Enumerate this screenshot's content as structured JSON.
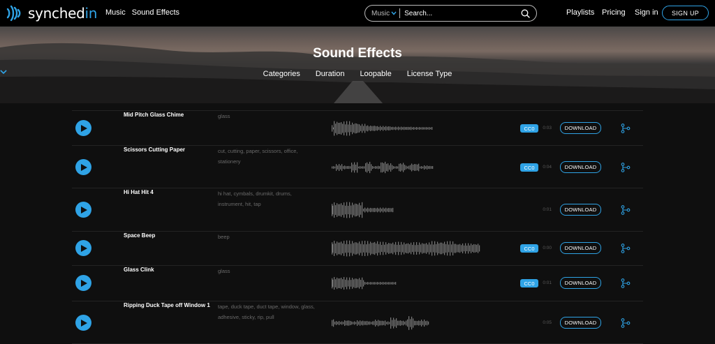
{
  "header": {
    "brand_prefix": "synched",
    "brand_suffix": "in",
    "nav": [
      "Music",
      "Sound Effects"
    ],
    "search": {
      "category": "Music",
      "placeholder": "Search..."
    },
    "right": {
      "playlists": "Playlists",
      "pricing": "Pricing",
      "signin": "Sign in",
      "signup": "SIGN UP"
    }
  },
  "hero": {
    "title": "Sound Effects",
    "filters": [
      "Categories",
      "Duration",
      "Loopable",
      "License Type"
    ]
  },
  "colors": {
    "accent": "#2fa3e6",
    "background": "#0f0f0f",
    "waveform": "#7a7a7a"
  },
  "rows": [
    {
      "title": "Mid Pitch Glass Chime",
      "tags": "glass",
      "badge": "CC0",
      "duration": "0:03",
      "download": "DOWNLOAD"
    },
    {
      "title": "Scissors Cutting Paper",
      "tags": "cut, cutting, paper, scissors, office, stationery",
      "badge": "CC0",
      "duration": "0:04",
      "download": "DOWNLOAD"
    },
    {
      "title": "Hi Hat Hit 4",
      "tags": "hi hat, cymbals, drumkit, drums, instrument, hit, tap",
      "badge": "",
      "duration": "0:01",
      "download": "DOWNLOAD"
    },
    {
      "title": "Space Beep",
      "tags": "beep",
      "badge": "CC0",
      "duration": "0:00",
      "download": "DOWNLOAD"
    },
    {
      "title": "Glass Clink",
      "tags": "glass",
      "badge": "CC0",
      "duration": "0:01",
      "download": "DOWNLOAD"
    },
    {
      "title": "Ripping Duck Tape off Window 1",
      "tags": "tape, duck tape, duct tape, window, glass, adhesive, sticky, rip, pull",
      "badge": "",
      "duration": "0:05",
      "download": "DOWNLOAD"
    }
  ]
}
